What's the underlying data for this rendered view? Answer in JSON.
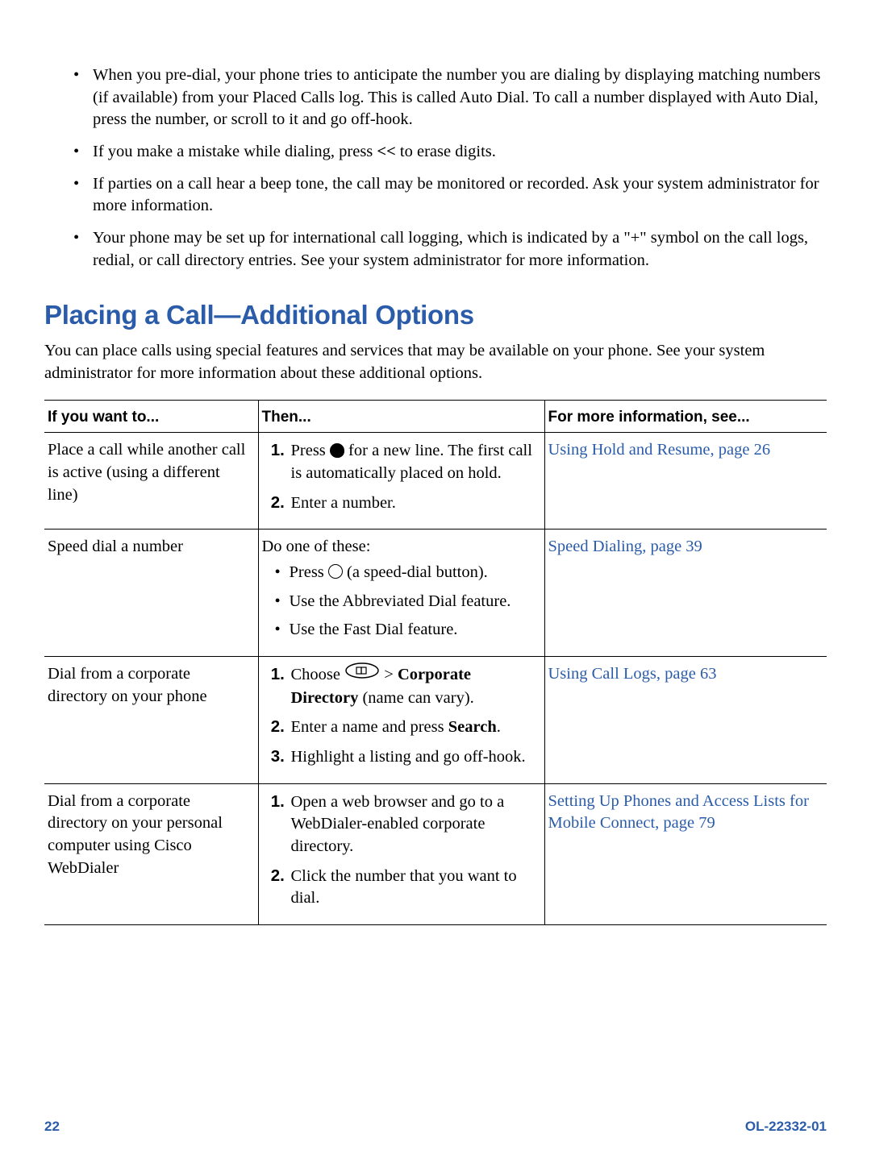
{
  "bullets": [
    "When you pre-dial, your phone tries to anticipate the number you are dialing by displaying matching numbers (if available) from your Placed Calls log. This is called Auto Dial. To call a number displayed with Auto Dial, press the number, or scroll to it and go off-hook.",
    "If you make a mistake while dialing, press << to erase digits.",
    "If parties on a call hear a beep tone, the call may be monitored or recorded. Ask your system administrator for more information.",
    "Your phone may be set up for international call logging, which is indicated by a \"+\" symbol on the call logs, redial, or call directory entries. See your system administrator for more information."
  ],
  "heading": "Placing a Call—Additional Options",
  "intro": "You can place calls using special features and services that may be available on your phone. See your system administrator for more information about these additional options.",
  "table": {
    "headers": [
      "If you want to...",
      "Then...",
      "For more information, see..."
    ],
    "rows": [
      {
        "want": "Place a call while another call is active (using a different line)",
        "steps_pre": "Press ",
        "steps_post": " for a new line. The first call is automatically placed on hold.",
        "step2": "Enter a number.",
        "link": "Using Hold and Resume, page 26"
      },
      {
        "want": "Speed dial a number",
        "lead": "Do one of these:",
        "sub_pre": "Press ",
        "sub_post": " (a speed-dial button).",
        "sub2": "Use the Abbreviated Dial feature.",
        "sub3": "Use the Fast Dial feature.",
        "link": "Speed Dialing, page 39"
      },
      {
        "want": "Dial from a corporate directory on your phone",
        "s1_pre": "Choose ",
        "s1_mid_gt": " > ",
        "s1_bold": "Corporate Directory",
        "s1_tail": " (name can vary).",
        "s2_a": "Enter a name and press ",
        "s2_b": "Search",
        "s2_c": ".",
        "s3": "Highlight a listing and go off-hook.",
        "link": "Using Call Logs, page 63"
      },
      {
        "want": "Dial from a corporate directory on your personal computer using Cisco WebDialer",
        "s1": "Open a web browser and go to a WebDialer-enabled corporate directory.",
        "s2": "Click the number that you want to dial.",
        "link": "Setting Up Phones and Access Lists for Mobile Connect, page 79"
      }
    ]
  },
  "footer": {
    "page": "22",
    "doc": "OL-22332-01"
  },
  "erase_key": "<<"
}
